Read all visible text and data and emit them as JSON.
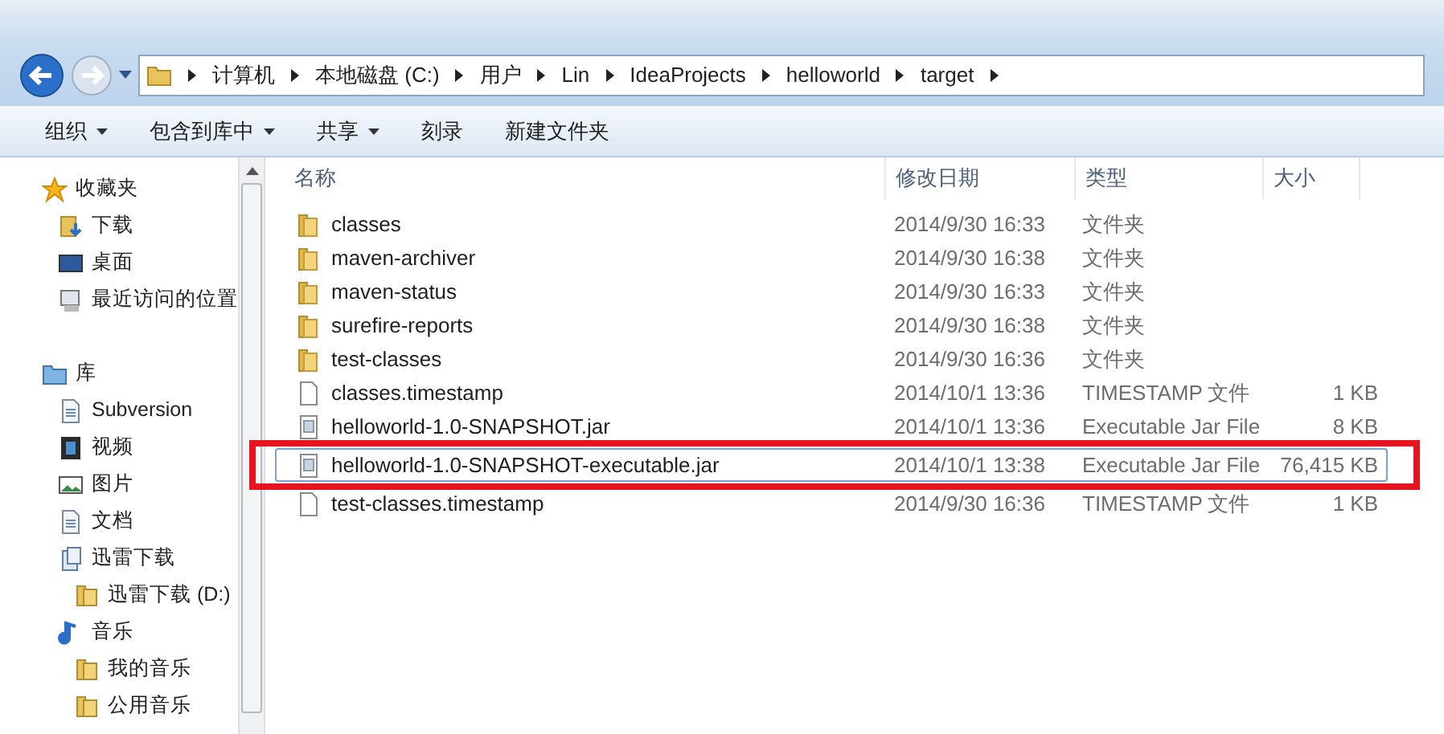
{
  "breadcrumb": [
    "计算机",
    "本地磁盘 (C:)",
    "用户",
    "Lin",
    "IdeaProjects",
    "helloworld",
    "target"
  ],
  "toolbar": [
    {
      "label": "组织",
      "dropdown": true
    },
    {
      "label": "包含到库中",
      "dropdown": true
    },
    {
      "label": "共享",
      "dropdown": true
    },
    {
      "label": "刻录",
      "dropdown": false
    },
    {
      "label": "新建文件夹",
      "dropdown": false
    }
  ],
  "sidebar": [
    {
      "label": "收藏夹",
      "kind": "star",
      "children": [
        {
          "label": "下载",
          "kind": "download"
        },
        {
          "label": "桌面",
          "kind": "desktop"
        },
        {
          "label": "最近访问的位置",
          "kind": "recent"
        }
      ]
    },
    {
      "label": "库",
      "kind": "library",
      "children": [
        {
          "label": "Subversion",
          "kind": "doc"
        },
        {
          "label": "视频",
          "kind": "video"
        },
        {
          "label": "图片",
          "kind": "picture"
        },
        {
          "label": "文档",
          "kind": "doc"
        },
        {
          "label": "迅雷下载",
          "kind": "lib",
          "children": [
            {
              "label": "迅雷下载 (D:)",
              "kind": "folder"
            }
          ]
        },
        {
          "label": "音乐",
          "kind": "music",
          "children": [
            {
              "label": "我的音乐",
              "kind": "folder"
            },
            {
              "label": "公用音乐",
              "kind": "folder"
            }
          ]
        }
      ]
    }
  ],
  "columns": [
    "名称",
    "修改日期",
    "类型",
    "大小"
  ],
  "rows": [
    {
      "name": "classes",
      "date": "2014/9/30 16:33",
      "type": "文件夹",
      "kind": "folder",
      "focused": false,
      "highlighted": false
    },
    {
      "name": "maven-archiver",
      "date": "2014/9/30 16:38",
      "type": "文件夹",
      "kind": "folder",
      "focused": false,
      "highlighted": false
    },
    {
      "name": "maven-status",
      "date": "2014/9/30 16:33",
      "type": "文件夹",
      "kind": "folder",
      "focused": false,
      "highlighted": false
    },
    {
      "name": "surefire-reports",
      "date": "2014/9/30 16:38",
      "type": "文件夹",
      "kind": "folder",
      "focused": false,
      "highlighted": false
    },
    {
      "name": "test-classes",
      "date": "2014/9/30 16:36",
      "type": "文件夹",
      "kind": "folder",
      "focused": false,
      "highlighted": false
    },
    {
      "name": "classes.timestamp",
      "date": "2014/10/1 13:36",
      "type": "TIMESTAMP 文件",
      "size": "1 KB",
      "kind": "file",
      "focused": false,
      "highlighted": false
    },
    {
      "name": "helloworld-1.0-SNAPSHOT.jar",
      "date": "2014/10/1 13:36",
      "type": "Executable Jar File",
      "size": "8 KB",
      "kind": "jar",
      "focused": false,
      "highlighted": false
    },
    {
      "name": "helloworld-1.0-SNAPSHOT-executable.jar",
      "date": "2014/10/1 13:38",
      "type": "Executable Jar File",
      "size": "76,415 KB",
      "kind": "jar",
      "focused": true,
      "highlighted": true
    },
    {
      "name": "test-classes.timestamp",
      "date": "2014/9/30 16:36",
      "type": "TIMESTAMP 文件",
      "size": "1 KB",
      "kind": "file",
      "focused": false,
      "highlighted": false
    }
  ]
}
